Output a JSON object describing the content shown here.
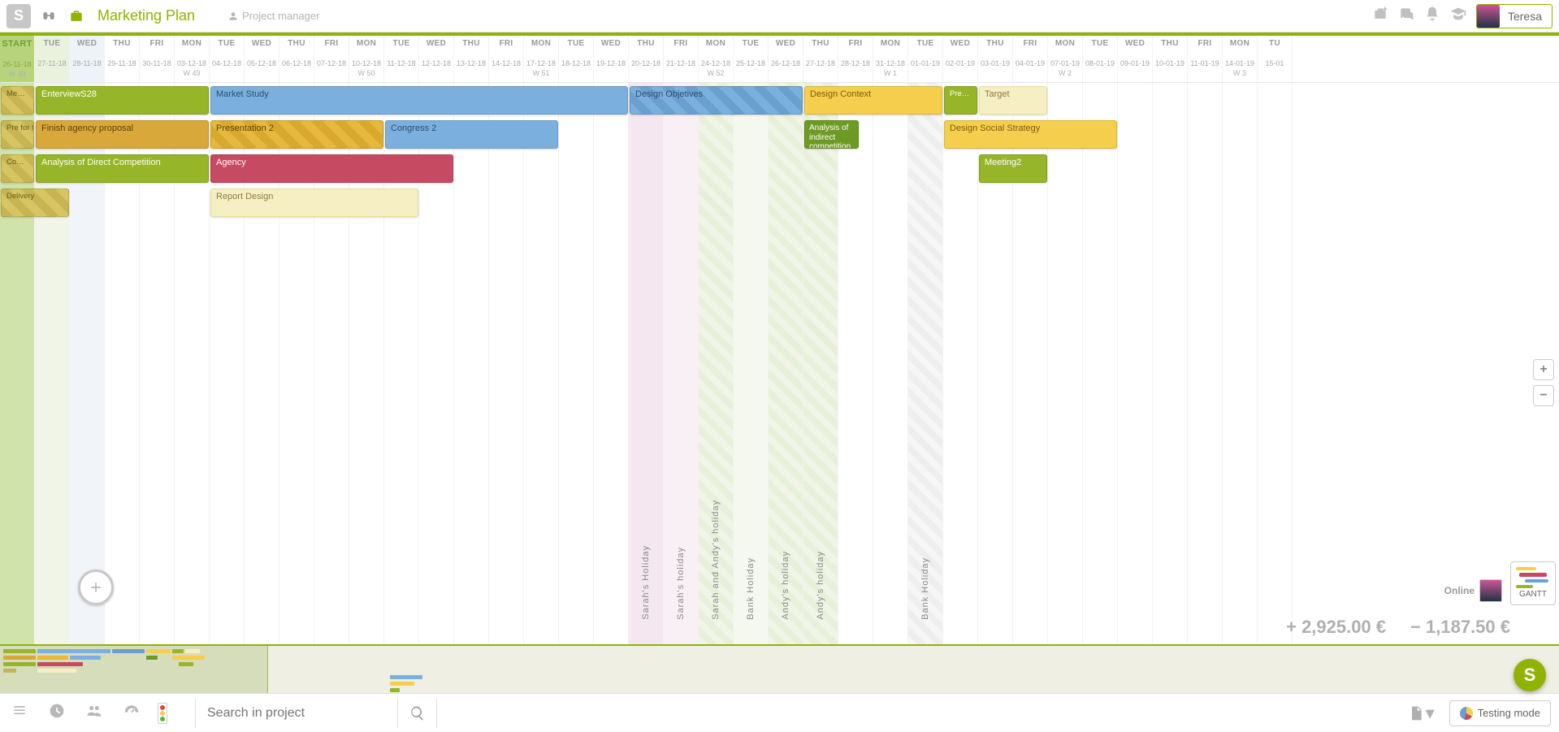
{
  "header": {
    "title": "Marketing Plan",
    "role": "Project manager",
    "user": "Teresa"
  },
  "columns": [
    {
      "dow": "START",
      "date": "26-11-18",
      "wk": "W 48",
      "cls": "start"
    },
    {
      "dow": "TUE",
      "date": "27-11-18",
      "cls": "past"
    },
    {
      "dow": "WED",
      "date": "28-11-18",
      "cls": "today"
    },
    {
      "dow": "THU",
      "date": "29-11-18"
    },
    {
      "dow": "FRI",
      "date": "30-11-18"
    },
    {
      "dow": "MON",
      "date": "03-12-18",
      "wk": "W 49"
    },
    {
      "dow": "TUE",
      "date": "04-12-18"
    },
    {
      "dow": "WED",
      "date": "05-12-18"
    },
    {
      "dow": "THU",
      "date": "06-12-18"
    },
    {
      "dow": "FRI",
      "date": "07-12-18"
    },
    {
      "dow": "MON",
      "date": "10-12-18",
      "wk": "W 50"
    },
    {
      "dow": "TUE",
      "date": "11-12-18"
    },
    {
      "dow": "WED",
      "date": "12-12-18"
    },
    {
      "dow": "THU",
      "date": "13-12-18"
    },
    {
      "dow": "FRI",
      "date": "14-12-18"
    },
    {
      "dow": "MON",
      "date": "17-12-18",
      "wk": "W 51"
    },
    {
      "dow": "TUE",
      "date": "18-12-18"
    },
    {
      "dow": "WED",
      "date": "19-12-18"
    },
    {
      "dow": "THU",
      "date": "20-12-18",
      "hol": "hol-pink",
      "label": "Sarah's Holiday"
    },
    {
      "dow": "FRI",
      "date": "21-12-18",
      "hol": "hol-pink2",
      "label": "Sarah's holiday"
    },
    {
      "dow": "MON",
      "date": "24-12-18",
      "wk": "W 52",
      "hol": "hol-green",
      "label": "Sarah and Andy's holiday"
    },
    {
      "dow": "TUE",
      "date": "25-12-18",
      "hol": "hol-green-s",
      "label": "Bank Holiday"
    },
    {
      "dow": "WED",
      "date": "26-12-18",
      "hol": "hol-green",
      "label": "Andy's holiday"
    },
    {
      "dow": "THU",
      "date": "27-12-18",
      "hol": "hol-green",
      "label": "Andy's holiday"
    },
    {
      "dow": "FRI",
      "date": "28-12-18"
    },
    {
      "dow": "MON",
      "date": "31-12-18",
      "wk": "W 1"
    },
    {
      "dow": "TUE",
      "date": "01-01-19",
      "hol": "hol-grey",
      "label": "Bank Holiday"
    },
    {
      "dow": "WED",
      "date": "02-01-19"
    },
    {
      "dow": "THU",
      "date": "03-01-19"
    },
    {
      "dow": "FRI",
      "date": "04-01-19"
    },
    {
      "dow": "MON",
      "date": "07-01-19",
      "wk": "W 2"
    },
    {
      "dow": "TUE",
      "date": "08-01-19"
    },
    {
      "dow": "WED",
      "date": "09-01-19"
    },
    {
      "dow": "THU",
      "date": "10-01-19"
    },
    {
      "dow": "FRI",
      "date": "11-01-19"
    },
    {
      "dow": "MON",
      "date": "14-01-19",
      "wk": "W 3"
    },
    {
      "dow": "TU",
      "date": "15-01"
    }
  ],
  "tasks": [
    {
      "label": "Me…",
      "row": 0,
      "start": 0,
      "span": 1,
      "cls": "olivepat small"
    },
    {
      "label": "EnterviewS28",
      "row": 0,
      "start": 1,
      "span": 5,
      "cls": "olive"
    },
    {
      "label": "Market Study",
      "row": 0,
      "start": 6,
      "span": 12,
      "cls": "blue"
    },
    {
      "label": "Design Objetives",
      "row": 0,
      "start": 18,
      "span": 5,
      "cls": "bluepat"
    },
    {
      "label": "Design Context",
      "row": 0,
      "start": 23,
      "span": 4,
      "cls": "yellow"
    },
    {
      "label": "Pre…",
      "row": 0,
      "start": 27,
      "span": 1,
      "cls": "olive small"
    },
    {
      "label": "Target",
      "row": 0,
      "start": 28,
      "span": 2,
      "cls": "cream"
    },
    {
      "label": "Pre for the",
      "row": 1,
      "start": 0,
      "span": 1,
      "cls": "olivepat small"
    },
    {
      "label": "Finish agency proposal",
      "row": 1,
      "start": 1,
      "span": 5,
      "cls": "mustard"
    },
    {
      "label": "Presentation 2",
      "row": 1,
      "start": 6,
      "span": 5,
      "cls": "yellowpat"
    },
    {
      "label": "Congress 2",
      "row": 1,
      "start": 11,
      "span": 5,
      "cls": "blue"
    },
    {
      "label": "Analysis of indirect competition",
      "row": 1,
      "start": 23,
      "span": 1.6,
      "cls": "dkolive"
    },
    {
      "label": "Design Social Strategy",
      "row": 1,
      "start": 27,
      "span": 5,
      "cls": "yellow"
    },
    {
      "label": "Co…",
      "row": 2,
      "start": 0,
      "span": 1,
      "cls": "olivepat small"
    },
    {
      "label": "Analysis of Direct Competition",
      "row": 2,
      "start": 1,
      "span": 5,
      "cls": "olive"
    },
    {
      "label": "Agency",
      "row": 2,
      "start": 6,
      "span": 7,
      "cls": "red"
    },
    {
      "label": "Meeting2",
      "row": 2,
      "start": 28,
      "span": 2,
      "cls": "olive"
    },
    {
      "label": "Delivery",
      "row": 3,
      "start": 0,
      "span": 2,
      "cls": "olivepat small"
    },
    {
      "label": "Report Design",
      "row": 3,
      "start": 6,
      "span": 6,
      "cls": "cream"
    }
  ],
  "totals": {
    "plus": "2,925.00 €",
    "minus": "1,187.50 €"
  },
  "search": {
    "placeholder": "Search in project"
  },
  "footer": {
    "testing": "Testing mode",
    "gantt": "GANTT",
    "online": "Online"
  }
}
